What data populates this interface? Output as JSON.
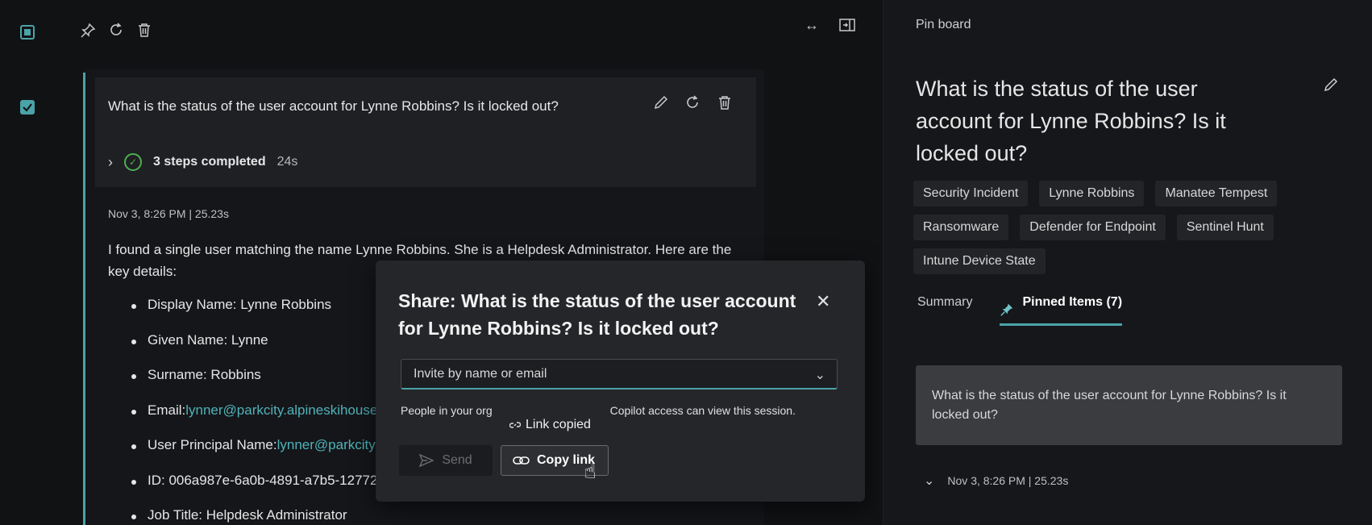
{
  "session": {
    "prompt": "What is the status of the user account for Lynne Robbins? Is it locked out?",
    "steps_label": "3 steps completed",
    "steps_duration": "24s",
    "meta": "Nov 3, 8:26 PM  |  25.23s",
    "answer_intro": "I found a single user matching the name Lynne Robbins. She is a Helpdesk Administrator. Here are the key details:",
    "details": [
      {
        "label": "Display Name: Lynne Robbins",
        "link": ""
      },
      {
        "label": "Given Name: Lynne",
        "link": ""
      },
      {
        "label": "Surname: Robbins",
        "link": ""
      },
      {
        "label": "Email: ",
        "link": "lynner@parkcity.alpineskihouse."
      },
      {
        "label": "User Principal Name: ",
        "link": "lynner@parkcity.a"
      },
      {
        "label": "ID: 006a987e-6a0b-4891-a7b5-127723",
        "link": ""
      },
      {
        "label": "Job Title: Helpdesk Administrator",
        "link": ""
      }
    ]
  },
  "share_modal": {
    "title": "Share: What is the status of the user account for Lynne Robbins? Is it locked out?",
    "invite_placeholder": "Invite by name or email",
    "note_start": "People in your org",
    "note_end": "Copilot access can view this session.",
    "toast": "Link copied",
    "send_label": "Send",
    "copy_label": "Copy link"
  },
  "pin_board": {
    "title": "Pin board",
    "question": "What is the status of the user account for Lynne Robbins? Is it locked out?",
    "tags": [
      "Security Incident",
      "Lynne Robbins",
      "Manatee Tempest",
      "Ransomware",
      "Defender for Endpoint",
      "Sentinel Hunt",
      "Intune Device State"
    ],
    "tabs": {
      "summary": "Summary",
      "pinned": "Pinned Items (7)"
    },
    "pinned_item": "What is the status of the user account for Lynne Robbins? Is it locked out?",
    "pinned_meta": "Nov 3, 8:26 PM  |  25.23s"
  },
  "colors": {
    "accent": "#4aa3a8",
    "success": "#4caf50",
    "link": "#4fb3b8"
  }
}
